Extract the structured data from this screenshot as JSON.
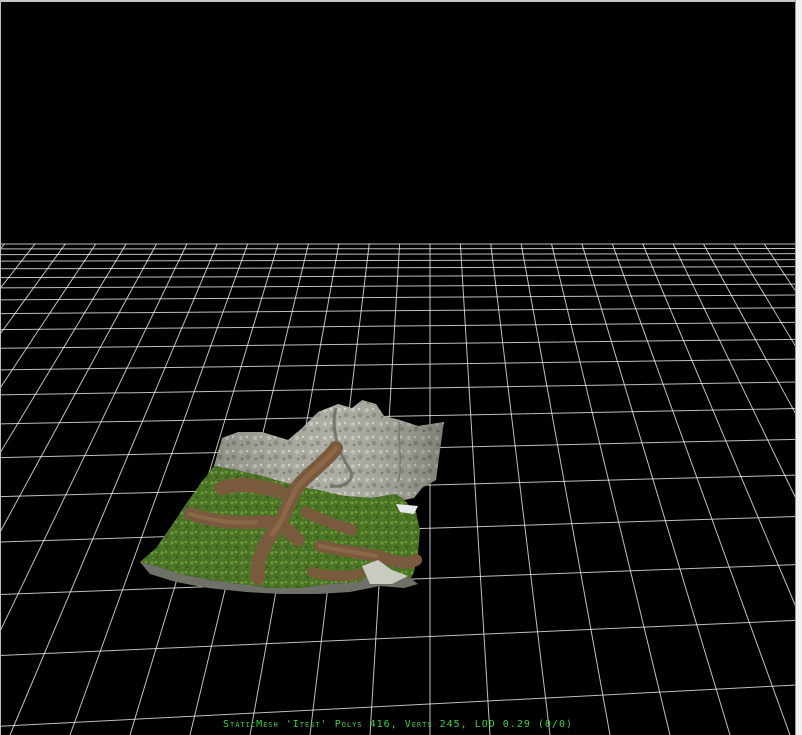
{
  "viewport": {
    "status_text": "StaticMesh 'Itest' Polys 416, Verts 245, LOD 0.29 (0/0)",
    "background_color": "#000000",
    "grid_color": "#ffffff",
    "status_color": "#3ecf3e",
    "mesh_grass_color": "#4f7a26",
    "mesh_path_color": "#7a5a3c",
    "mesh_rock_color": "#a9aa9e"
  }
}
